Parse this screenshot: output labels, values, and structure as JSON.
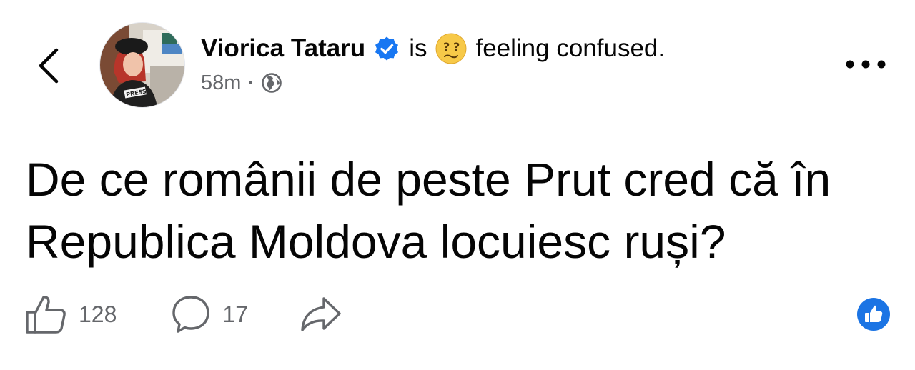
{
  "post": {
    "author_name": "Viorica Tataru",
    "feeling_prefix": "is",
    "feeling_text": "feeling confused.",
    "timestamp": "58m",
    "separator": "·",
    "body": "De ce românii de peste Prut cred că în Republica Moldova locuiesc ruși?",
    "avatar_badge_text": "PRESS"
  },
  "actions": {
    "like_count": "128",
    "comment_count": "17"
  },
  "icons": {
    "back": "chevron-left-icon",
    "verified": "verified-badge-icon",
    "feeling": "confused-face-emoji",
    "audience": "globe-icon",
    "more": "more-dots-icon",
    "like": "thumbs-up-icon",
    "comment": "comment-bubble-icon",
    "share": "share-arrow-icon",
    "reaction": "like-reaction-icon"
  },
  "colors": {
    "verified_blue": "#1877f2",
    "reaction_blue": "#1b74e4",
    "emoji_yellow": "#f7c948",
    "meta_gray": "#65676b",
    "text": "#050505"
  }
}
